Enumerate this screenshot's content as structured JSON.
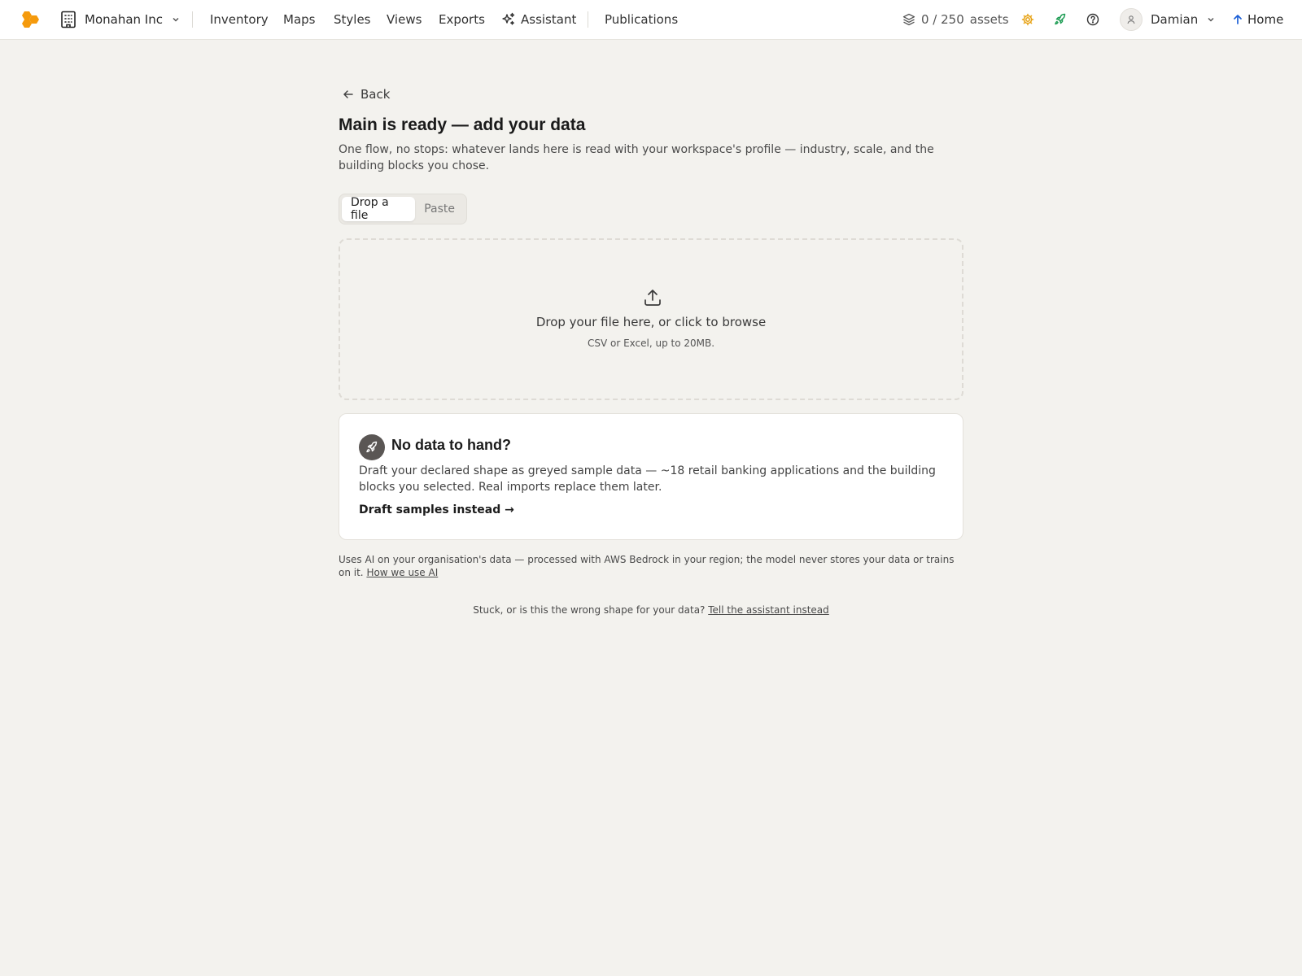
{
  "topbar": {
    "org_name": "Monahan Inc",
    "nav": [
      "Inventory",
      "Maps",
      "Styles",
      "Views",
      "Exports",
      "Assistant",
      "Publications"
    ],
    "assets": "0 / 250",
    "assets_unit": "assets",
    "user_name": "Damian",
    "home_label": "Home",
    "colors": {
      "brand": "#f59a0c",
      "gear": "#e7a317",
      "rocket": "#1f9d55",
      "home_arrow": "#1b5fd6"
    }
  },
  "main": {
    "back_label": "Back",
    "title": "Main is ready — add your data",
    "subtitle": "One flow, no stops: whatever lands here is read with your workspace's profile — industry, scale, and the building blocks you chose.",
    "tabs": [
      "Drop a file",
      "Paste"
    ],
    "active_tab": "Drop a file",
    "dropzone": {
      "main_text": "Drop your file here, or click to browse",
      "sub_text": "CSV or Excel, up to 20MB."
    },
    "card": {
      "title": "No data to hand?",
      "body": "Draft your declared shape as greyed sample data — ~18 retail banking applications and the building blocks you selected. Real imports replace them later.",
      "link": "Draft samples instead →"
    },
    "disclaimer": {
      "text": "Uses AI on your organisation's data — processed with AWS Bedrock in your region; the model never stores your data or trains on it. ",
      "link": "How we use AI"
    },
    "footer": {
      "text": "Stuck, or is this the wrong shape for your data? ",
      "link": "Tell the assistant instead"
    }
  }
}
